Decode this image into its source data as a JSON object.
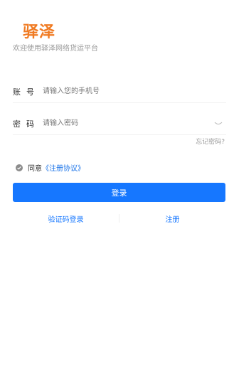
{
  "brand": {
    "name": "驿泽",
    "welcome": "欢迎使用驿泽网络货运平台",
    "color": "#f07b23"
  },
  "form": {
    "account": {
      "label_a": "账",
      "label_b": "号",
      "placeholder": "请输入您的手机号",
      "value": ""
    },
    "password": {
      "label_a": "密",
      "label_b": "码",
      "placeholder": "请输入密码",
      "value": ""
    },
    "forgot": "忘记密码?"
  },
  "agreement": {
    "prefix": "同意",
    "link": "《注册协议》",
    "checked": true
  },
  "actions": {
    "login": "登录",
    "code_login": "验证码登录",
    "register": "注册",
    "accent": "#1677ff"
  },
  "icons": {
    "password_toggle": "eye-closed-icon",
    "agree_check": "check-circle-icon"
  }
}
